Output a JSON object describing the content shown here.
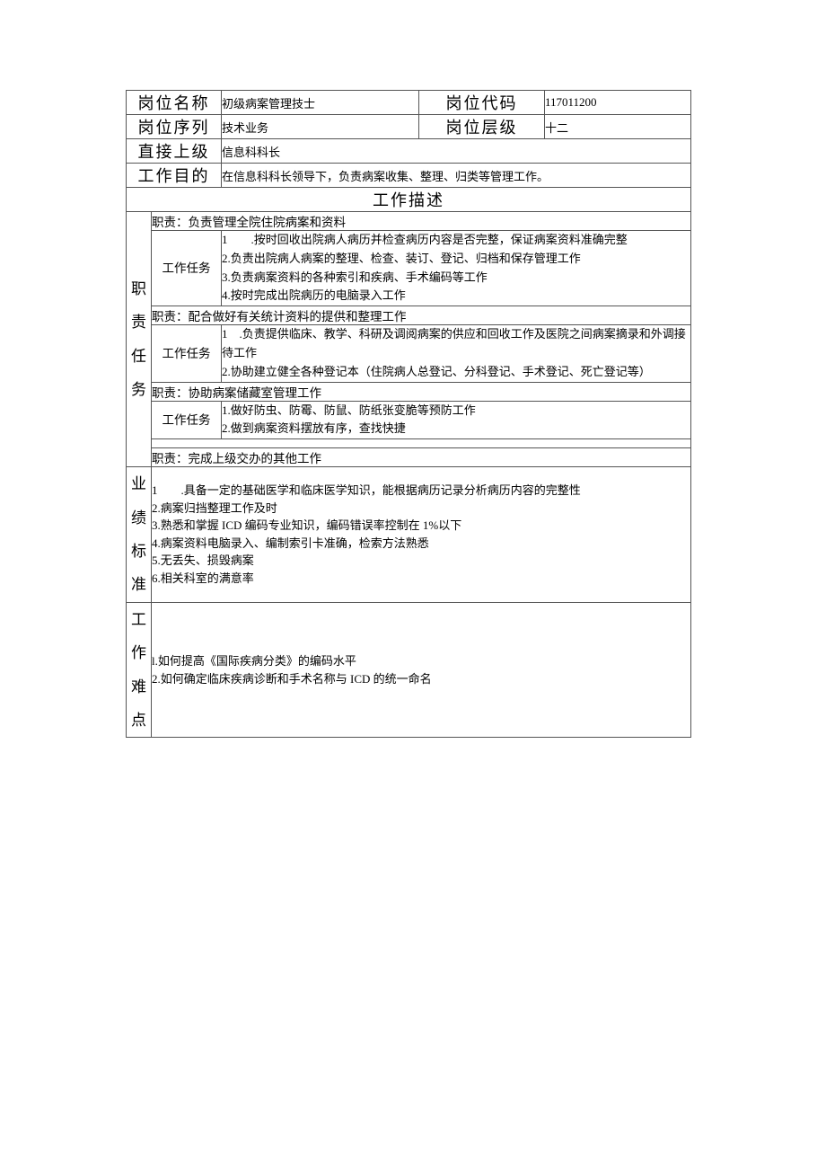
{
  "header": {
    "position_name_label": "岗位名称",
    "position_name": "初级病案管理技士",
    "position_code_label": "岗位代码",
    "position_code": "117011200",
    "position_series_label": "岗位序列",
    "position_series": "技术业务",
    "position_level_label": "岗位层级",
    "position_level": "十二",
    "supervisor_label": "直接上级",
    "supervisor": "信息科科长",
    "purpose_label": "工作目的",
    "purpose": "在信息科科长领导下，负责病案收集、整理、归类等管理工作。"
  },
  "description_title": "工作描述",
  "side": {
    "duties": "职\n责\n任\n务",
    "standards": "业\n绩\n标\n准",
    "difficulties": "工\n作\n难\n点"
  },
  "task_label": "工作任务",
  "duties": [
    {
      "title": "职责：负责管理全院住院病案和资料",
      "tasks": "1  .按时回收出院病人病历并检查病历内容是否完整，保证病案资料准确完整\n2.负责出院病人病案的整理、检查、装订、登记、归档和保存管理工作\n3.负责病案资料的各种索引和疾病、手术编码等工作\n4.按时完成出院病历的电脑录入工作"
    },
    {
      "title": "职责：配合做好有关统计资料的提供和整理工作",
      "tasks": "1 .负责提供临床、教学、科研及调阅病案的供应和回收工作及医院之间病案摘录和外调接待工作\n2.协助建立健全各种登记本（住院病人总登记、分科登记、手术登记、死亡登记等）"
    },
    {
      "title": "职责：协助病案储藏室管理工作",
      "tasks": "1.做好防虫、防霉、防鼠、防纸张变脆等预防工作\n2.做到病案资料摆放有序，查找快捷"
    },
    {
      "title": "职责：完成上级交办的其他工作",
      "tasks": null
    }
  ],
  "standards": "1  .具备一定的基础医学和临床医学知识，能根据病历记录分析病历内容的完整性\n2.病案归挡整理工作及时\n3.熟悉和掌握 ICD 编码专业知识，编码错误率控制在 1%以下\n4.病案资料电脑录入、编制索引卡准确，检索方法熟悉\n5.无丢失、损毁病案\n6.相关科室的满意率",
  "difficulties": "l.如何提高《国际疾病分类》的编码水平\n2.如何确定临床疾病诊断和手术名称与 ICD 的统一命名"
}
